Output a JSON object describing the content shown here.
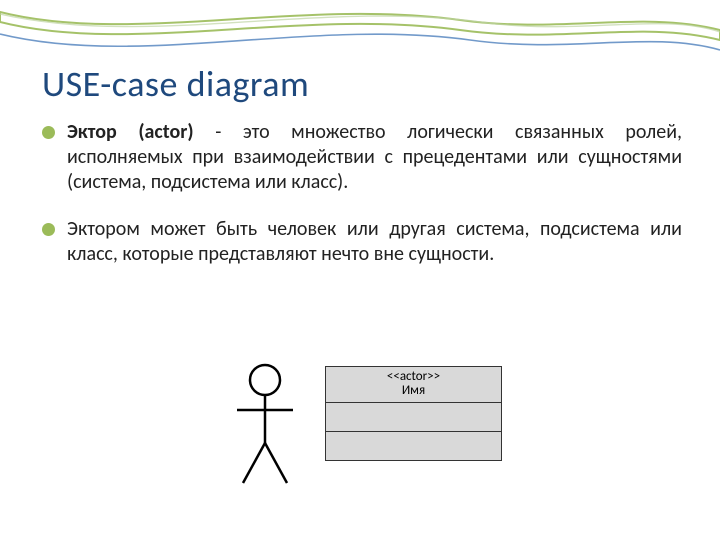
{
  "title": "USE-case diagram",
  "bullets": [
    {
      "bold": "Эктор (actor)",
      "rest": " - это множество логически связанных ролей, исполняемых при взаимодействии с прецедентами или сущностями (система, подсистема или класс)."
    },
    {
      "bold": "",
      "rest": "Эктором может быть человек или другая система, подсистема или класс, которые представляют нечто вне сущности."
    }
  ],
  "actor_box": {
    "stereotype": "<<actor>>",
    "name": "Имя"
  }
}
